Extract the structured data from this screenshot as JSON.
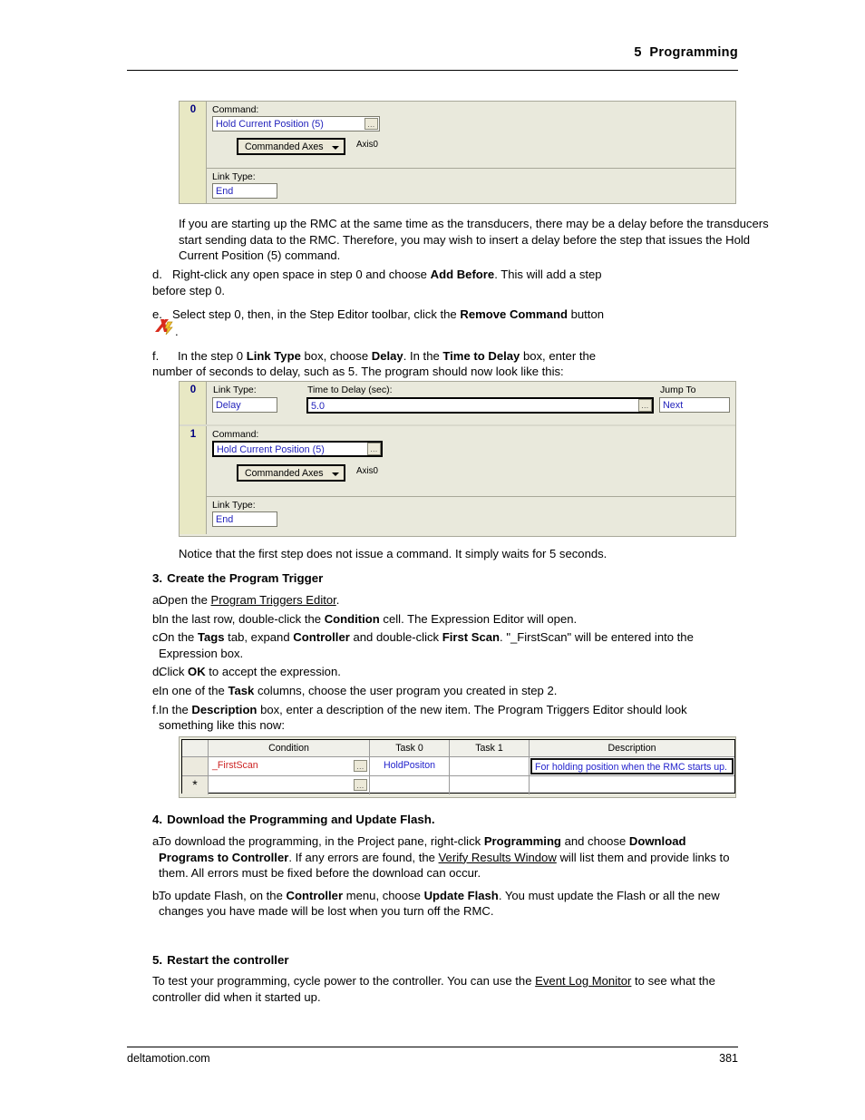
{
  "header": {
    "chapter_title": "5  Programming"
  },
  "footer": {
    "site": "deltamotion.com",
    "page_number": "381"
  },
  "figure1": {
    "caption_alt": "RMC Step Editor showing step 0 with Hold Current Position command",
    "steps": [
      {
        "number": "0",
        "command_label": "Command:",
        "command_value": "Hold Current Position (5)",
        "ellipsis": "...",
        "axes_dropdown": "Commanded Axes",
        "axis_label": "Axis0",
        "link_type_label": "Link Type:",
        "link_type_value": "End"
      }
    ]
  },
  "paragraph_rmc_delay": "If you are starting up the RMC at the same time as the transducers, there may be a delay before the transducers start sending data to the RMC. Therefore, you may wish to insert a delay before the step that issues the Hold Current Position (5) command.",
  "step_items_2": [
    {
      "marker": "d.",
      "parts": [
        {
          "t": "Right-click any open space in step 0 and choose ",
          "s": "n"
        },
        {
          "t": "Add Before",
          "s": "b"
        },
        {
          "t": ". This will add a step before step 0.",
          "s": "n"
        }
      ]
    },
    {
      "marker": "e.",
      "parts": [
        {
          "t": "Select step 0, then, in the Step Editor toolbar, click the ",
          "s": "n"
        },
        {
          "t": "Remove Command",
          "s": "b"
        },
        {
          "t": " button",
          "s": "n"
        }
      ]
    },
    {
      "marker": "f.",
      "parts": [
        {
          "t": "In the step 0 ",
          "s": "n"
        },
        {
          "t": "Link Type",
          "s": "b"
        },
        {
          "t": " box, choose ",
          "s": "n"
        },
        {
          "t": "Delay",
          "s": "b"
        },
        {
          "t": ". In the ",
          "s": "n"
        },
        {
          "t": "Time to Delay",
          "s": "b"
        },
        {
          "t": " box, enter the number of seconds to delay, such as 5. The program should now look like this:",
          "s": "n"
        }
      ]
    }
  ],
  "icons": {
    "remove_command": "remove-command-icon",
    "ellipsis_button": "ellipsis-button-icon",
    "dropdown_arrow": "chevron-down-icon",
    "new_row_star": "new-row-star-icon"
  },
  "figure2": {
    "step0": {
      "number": "0",
      "link_type_label": "Link Type:",
      "link_type_value": "Delay",
      "time_label": "Time to Delay (sec):",
      "time_value": "5.0",
      "ellipsis": "...",
      "jump_label": "Jump To",
      "jump_value": "Next"
    },
    "step1": {
      "number": "1",
      "command_label": "Command:",
      "command_value": "Hold Current Position (5)",
      "ellipsis": "...",
      "axes_dropdown": "Commanded Axes",
      "axis_label": "Axis0",
      "link_type_label": "Link Type:",
      "link_type_value": "End"
    }
  },
  "paragraph_notice": "Notice that the first step does not issue a command. It simply waits for 5 seconds.",
  "section3": {
    "number": "3.",
    "title": "Create the Program Trigger",
    "items": [
      {
        "marker": "a.",
        "parts": [
          {
            "t": "Open the ",
            "s": "n"
          },
          {
            "t": "Program Triggers Editor",
            "s": "u"
          },
          {
            "t": ".",
            "s": "n"
          }
        ]
      },
      {
        "marker": "b.",
        "parts": [
          {
            "t": "In the last row, double-click the ",
            "s": "n"
          },
          {
            "t": "Condition",
            "s": "b"
          },
          {
            "t": " cell. The Expression Editor will open.",
            "s": "n"
          }
        ]
      },
      {
        "marker": "c.",
        "parts": [
          {
            "t": "On the ",
            "s": "n"
          },
          {
            "t": "Tags",
            "s": "b"
          },
          {
            "t": " tab, expand ",
            "s": "n"
          },
          {
            "t": "Controller",
            "s": "b"
          },
          {
            "t": " and double-click ",
            "s": "n"
          },
          {
            "t": "First Scan",
            "s": "b"
          },
          {
            "t": ". \"_FirstScan\" will be entered into the Expression box.",
            "s": "n"
          }
        ]
      },
      {
        "marker": "d.",
        "parts": [
          {
            "t": "Click ",
            "s": "n"
          },
          {
            "t": "OK",
            "s": "b"
          },
          {
            "t": " to accept the expression.",
            "s": "n"
          }
        ]
      },
      {
        "marker": "e.",
        "parts": [
          {
            "t": "In one of the ",
            "s": "n"
          },
          {
            "t": "Task",
            "s": "b"
          },
          {
            "t": " columns, choose the user program you created in step 2.",
            "s": "n"
          }
        ]
      },
      {
        "marker": "f.",
        "parts": [
          {
            "t": "In the ",
            "s": "n"
          },
          {
            "t": "Description",
            "s": "b"
          },
          {
            "t": " box, enter a description of the new item. The Program Triggers Editor should look something like this now:",
            "s": "n"
          }
        ]
      }
    ]
  },
  "triggers_grid": {
    "columns": [
      "",
      "Condition",
      "Task 0",
      "Task 1",
      "Description"
    ],
    "rows": [
      {
        "selector": "",
        "condition": "_FirstScan",
        "condition_ellipsis": "...",
        "task0": "HoldPositon",
        "task1": "",
        "description": "For holding position when the RMC starts up."
      },
      {
        "selector": "*",
        "condition": "",
        "condition_ellipsis": "...",
        "task0": "",
        "task1": "",
        "description": ""
      }
    ]
  },
  "section4": {
    "number": "4.",
    "title": "Download the Programming and Update Flash.",
    "items": [
      {
        "marker": "a.",
        "parts": [
          {
            "t": "To download the programming, in the Project pane, right-click ",
            "s": "n"
          },
          {
            "t": "Programming",
            "s": "b"
          },
          {
            "t": " and choose ",
            "s": "n"
          },
          {
            "t": "Download Programs to Controller",
            "s": "b"
          },
          {
            "t": ". If any errors are found, the ",
            "s": "n"
          },
          {
            "t": "Verify Results Window",
            "s": "u"
          },
          {
            "t": " will list them and provide links to them. All errors must be fixed before the download can occur.",
            "s": "n"
          }
        ]
      },
      {
        "marker": "b.",
        "parts": [
          {
            "t": "To update Flash, on the ",
            "s": "n"
          },
          {
            "t": "Controller",
            "s": "b"
          },
          {
            "t": " menu, choose ",
            "s": "n"
          },
          {
            "t": "Update Flash",
            "s": "b"
          },
          {
            "t": ". You must update the Flash or all the new changes you have made will be lost when you turn off the RMC.",
            "s": "n"
          }
        ]
      }
    ]
  },
  "section5": {
    "number": "5.",
    "title": "Restart the controller",
    "paragraph_parts": [
      {
        "t": "To test your programming, cycle power to the controller. You can use the ",
        "s": "n"
      },
      {
        "t": "Event Log Monitor",
        "s": "u"
      },
      {
        "t": " to see what the controller did when it started up.",
        "s": "n"
      }
    ]
  },
  "colors": {
    "figure_bg": "#e9e9dc",
    "step_col_bg": "#e8e8c4",
    "field_text": "#2222bb",
    "step_num": "#000080",
    "condition_value": "#cc2222",
    "task_value": "#2222cc",
    "border": "#a8a899"
  }
}
